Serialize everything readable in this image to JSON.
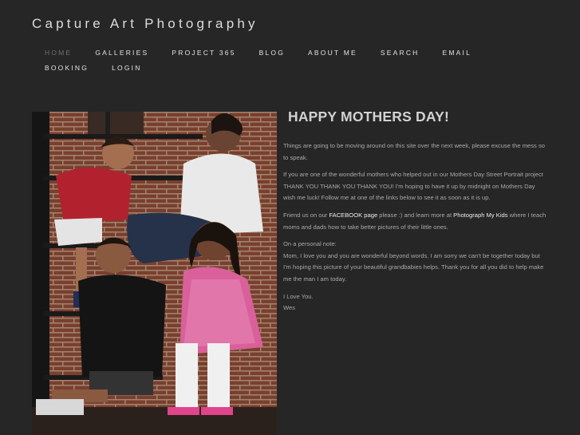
{
  "site": {
    "title": "Capture Art Photography"
  },
  "nav": {
    "items": [
      {
        "label": "HOME",
        "active": true
      },
      {
        "label": "GALLERIES"
      },
      {
        "label": "PROJECT 365"
      },
      {
        "label": "BLOG"
      },
      {
        "label": "ABOUT ME"
      },
      {
        "label": "SEARCH"
      },
      {
        "label": "EMAIL"
      },
      {
        "label": "BOOKING"
      },
      {
        "label": "LOGIN"
      }
    ]
  },
  "post": {
    "title": "HAPPY MOTHERS DAY!",
    "p1": "Things are going to be moving around on this site over the next week, please excuse the mess so to speak.",
    "p2": "If you are one of the wonderful mothers who helped out in our Mothers Day Street Portrait project THANK YOU THANK YOU THANK YOU! I'm hoping to have it up by midnight on Mothers Day wish me luck! Follow me at one of the links below to see it as soon as it is up.",
    "p3_a": "Friend us on our ",
    "p3_link1": "FACEBOOK page",
    "p3_b": " please :) and learn more at ",
    "p3_link2": "Photograph My Kids",
    "p3_c": " where I teach moms and dads how to take better pictures of their little ones.",
    "p4_line1": "On a personal note:",
    "p4_line2": "Mom, I love you and you are wonderful beyond words. I am sorry we can't be together today but I'm hoping this picture of your beautiful grandbabies helps. Thank you for all you did to help make me the man I am today.",
    "p5_line1": "I Love You.",
    "p5_line2": "Wes"
  },
  "colors": {
    "background": "#262626",
    "nav_active": "#707070",
    "brick": "#7a3f2e"
  }
}
